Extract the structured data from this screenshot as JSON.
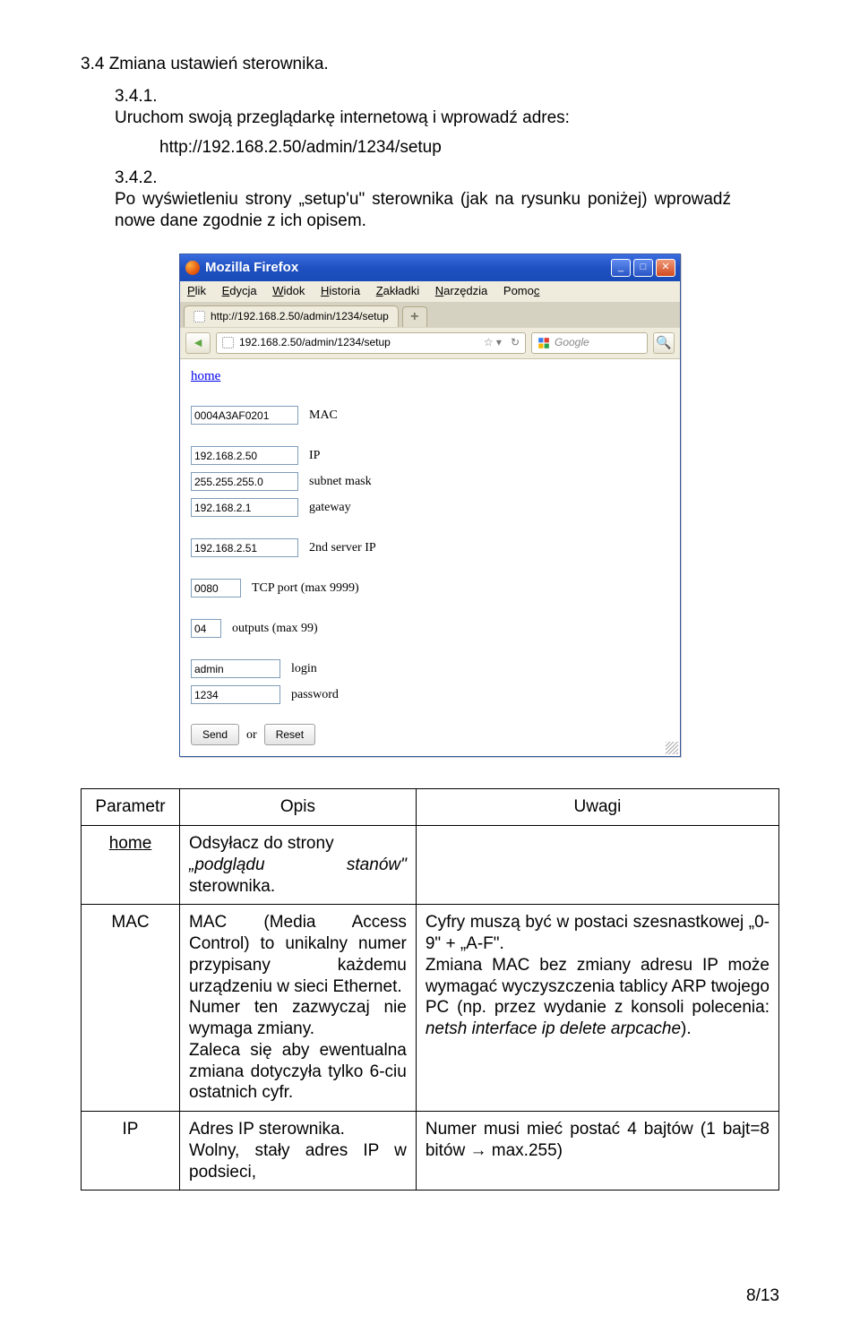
{
  "section_title": "3.4 Zmiana ustawień sterownika.",
  "step1_num": "3.4.1.",
  "step1_text": "Uruchom swoją przeglądarkę internetową i wprowadź adres:",
  "step1_url": "http://192.168.2.50/admin/1234/setup",
  "step2_num": "3.4.2.",
  "step2_text": "Po wyświetleniu strony „setup'u\" sterownika (jak na rysunku poniżej) wprowadź nowe dane zgodnie z ich opisem.",
  "browser": {
    "title": "Mozilla Firefox",
    "menus": {
      "file": "Plik",
      "edit": "Edycja",
      "view": "Widok",
      "history": "Historia",
      "bookmarks": "Zakładki",
      "tools": "Narzędzia",
      "help": "Pomoc"
    },
    "tab_label": "http://192.168.2.50/admin/1234/setup",
    "url": "192.168.2.50/admin/1234/setup",
    "search_placeholder": "Google",
    "form": {
      "home": "home",
      "mac": {
        "value": "0004A3AF0201",
        "label": "MAC"
      },
      "ip": {
        "value": "192.168.2.50",
        "label": "IP"
      },
      "mask": {
        "value": "255.255.255.0",
        "label": "subnet mask"
      },
      "gw": {
        "value": "192.168.2.1",
        "label": "gateway"
      },
      "srvip": {
        "value": "192.168.2.51",
        "label": "2nd server IP"
      },
      "port": {
        "value": "0080",
        "label": "TCP port (max 9999)"
      },
      "outs": {
        "value": "04",
        "label": "outputs (max 99)"
      },
      "login": {
        "value": "admin",
        "label": "login"
      },
      "pass": {
        "value": "1234",
        "label": "password"
      },
      "send": "Send",
      "or": "or",
      "reset": "Reset"
    }
  },
  "table": {
    "h1": "Parametr",
    "h2": "Opis",
    "h3": "Uwagi",
    "home": {
      "name": "home",
      "desc1": "Odsyłacz do strony",
      "desc_em": "„podglądu stanów\"",
      "desc2": " sterownika."
    },
    "mac": {
      "name": "MAC",
      "desc": "MAC (Media Access Control) to unikalny numer przypisany każdemu urządzeniu w sieci Ethernet.\nNumer ten zazwyczaj nie wymaga zmiany.\nZaleca się aby ewentualna zmiana dotyczyła tylko 6-ciu ostatnich cyfr.",
      "note_a": "Cyfry muszą być w postaci szesnastkowej „0-9\" + „A-F\".\nZmiana MAC bez zmiany adresu IP może wymagać wyczyszczenia tablicy ARP twojego PC (np. przez wydanie z konsoli polecenia: ",
      "note_em": "netsh interface ip delete arpcache",
      "note_b": ")."
    },
    "ip": {
      "name": "IP",
      "desc": "Adres IP sterownika.\nWolny, stały adres IP w podsieci,",
      "note": "Numer musi mieć postać 4 bajtów (1 bajt=8 bitów → max.255)"
    }
  },
  "footer": "8/13"
}
